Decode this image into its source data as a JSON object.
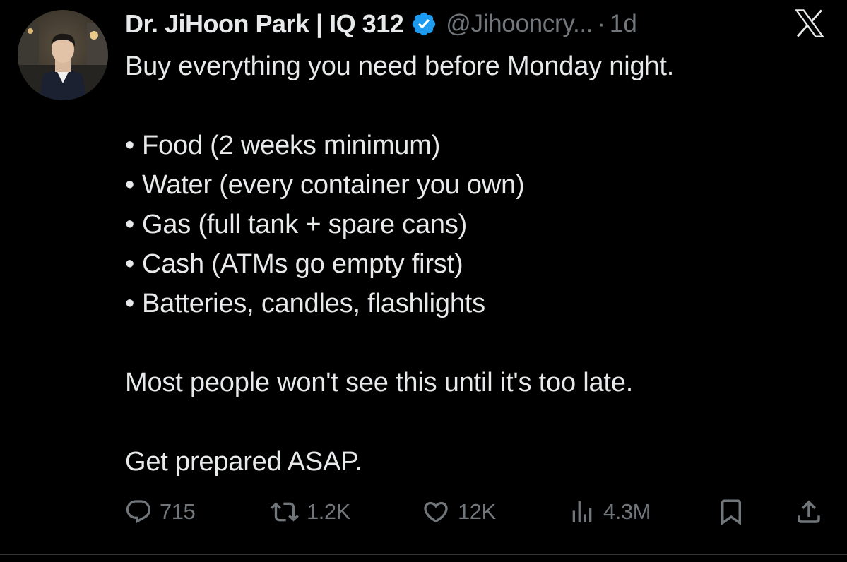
{
  "author": {
    "display_name": "Dr. JiHoon Park | IQ 312",
    "handle": "@Jihooncry...",
    "separator": "·",
    "time": "1d",
    "verified_icon": "verified-badge-icon"
  },
  "brand": {
    "logo": "x-logo-icon"
  },
  "tweet": {
    "intro": "Buy everything you need before Monday night.",
    "bullet_mark": "•",
    "bullets": [
      "Food (2 weeks minimum)",
      "Water (every container you own)",
      "Gas (full tank + spare cans)",
      "Cash (ATMs go empty first)",
      "Batteries, candles, flashlights"
    ],
    "warning": "Most people won't see this until it's too late.",
    "closing": "Get prepared ASAP."
  },
  "actions": {
    "replies": {
      "icon": "reply-icon",
      "count": "715"
    },
    "reposts": {
      "icon": "repost-icon",
      "count": "1.2K"
    },
    "likes": {
      "icon": "heart-icon",
      "count": "12K"
    },
    "views": {
      "icon": "views-icon",
      "count": "4.3M"
    },
    "bookmark": {
      "icon": "bookmark-icon"
    },
    "share": {
      "icon": "share-icon"
    }
  },
  "colors": {
    "background": "#000000",
    "text_primary": "#e7e9ea",
    "text_secondary": "#71767b",
    "verified_blue": "#1d9bf0"
  }
}
